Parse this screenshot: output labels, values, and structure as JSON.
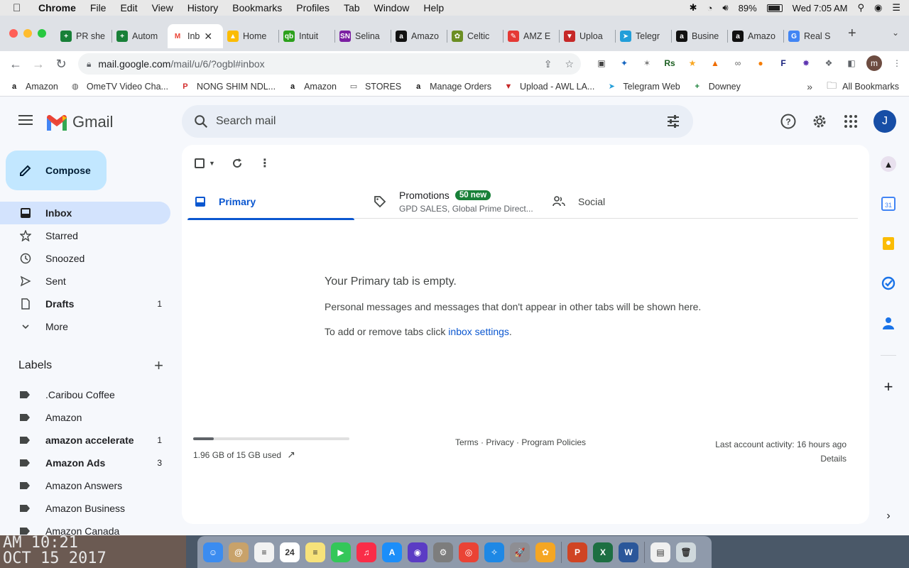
{
  "menubar": {
    "app": "Chrome",
    "items": [
      "File",
      "Edit",
      "View",
      "History",
      "Bookmarks",
      "Profiles",
      "Tab",
      "Window",
      "Help"
    ],
    "battery": "89%",
    "clock": "Wed 7:05 AM"
  },
  "tabs": [
    {
      "label": "PR she",
      "color": "#188038",
      "glyph": "+"
    },
    {
      "label": "Autom",
      "color": "#188038",
      "glyph": "+"
    },
    {
      "label": "Inb",
      "color": "#ffffff",
      "glyph": "M",
      "active": true
    },
    {
      "label": "Home",
      "color": "#fbbc04",
      "glyph": "▲"
    },
    {
      "label": "Intuit",
      "color": "#2ca01c",
      "glyph": "qb"
    },
    {
      "label": "Selina",
      "color": "#7b1fa2",
      "glyph": "SN"
    },
    {
      "label": "Amazo",
      "color": "#111111",
      "glyph": "a"
    },
    {
      "label": "Celtic",
      "color": "#6b8e23",
      "glyph": "✿"
    },
    {
      "label": "AMZ E",
      "color": "#e53935",
      "glyph": "✎"
    },
    {
      "label": "Uploa",
      "color": "#c62828",
      "glyph": "▼"
    },
    {
      "label": "Telegr",
      "color": "#229ed9",
      "glyph": "➤"
    },
    {
      "label": "Busine",
      "color": "#111111",
      "glyph": "a"
    },
    {
      "label": "Amazo",
      "color": "#111111",
      "glyph": "a"
    },
    {
      "label": "Real S",
      "color": "#4285f4",
      "glyph": "G"
    }
  ],
  "address": {
    "host": "mail.google.com",
    "path": "/mail/u/6/?ogbl#inbox"
  },
  "bookmarks": [
    {
      "label": "Amazon",
      "color": "#111111",
      "glyph": "a"
    },
    {
      "label": "OmeTV Video Cha...",
      "color": "#555555",
      "glyph": "◍"
    },
    {
      "label": "NONG SHIM NDL...",
      "color": "#d32f2f",
      "glyph": "P"
    },
    {
      "label": "Amazon",
      "color": "#111111",
      "glyph": "a"
    },
    {
      "label": "STORES",
      "color": "#555555",
      "glyph": "▭"
    },
    {
      "label": "Manage Orders",
      "color": "#111111",
      "glyph": "a"
    },
    {
      "label": "Upload - AWL LA...",
      "color": "#c62828",
      "glyph": "▼"
    },
    {
      "label": "Telegram Web",
      "color": "#229ed9",
      "glyph": "➤"
    },
    {
      "label": "Downey",
      "color": "#188038",
      "glyph": "+"
    }
  ],
  "bookmarks_more": "»",
  "bookmarks_all": "All Bookmarks",
  "gmail": {
    "logo_text": "Gmail",
    "search_placeholder": "Search mail",
    "avatar_letter": "J",
    "compose_label": "Compose",
    "nav": [
      {
        "label": "Inbox",
        "icon": "inbox-icon",
        "active": true,
        "count": ""
      },
      {
        "label": "Starred",
        "icon": "star-icon",
        "count": ""
      },
      {
        "label": "Snoozed",
        "icon": "clock-icon",
        "count": ""
      },
      {
        "label": "Sent",
        "icon": "send-icon",
        "count": ""
      },
      {
        "label": "Drafts",
        "icon": "draft-icon",
        "bold": true,
        "count": "1"
      },
      {
        "label": "More",
        "icon": "chevron-down-icon",
        "count": ""
      }
    ],
    "labels_title": "Labels",
    "labels": [
      {
        "label": ".Caribou Coffee",
        "count": ""
      },
      {
        "label": "Amazon",
        "count": ""
      },
      {
        "label": "amazon accelerate",
        "bold": true,
        "count": "1"
      },
      {
        "label": "Amazon Ads",
        "bold": true,
        "count": "3"
      },
      {
        "label": "Amazon Answers",
        "count": ""
      },
      {
        "label": "Amazon Business",
        "count": ""
      },
      {
        "label": "Amazon Canada",
        "count": ""
      }
    ],
    "categories": {
      "primary": "Primary",
      "promotions": "Promotions",
      "promotions_badge": "50 new",
      "promotions_sub": "GPD SALES, Global Prime Direct...",
      "social": "Social"
    },
    "empty": {
      "title": "Your Primary tab is empty.",
      "text": "Personal messages and messages that don't appear in other tabs will be shown here.",
      "settings_prefix": "To add or remove tabs click ",
      "settings_link": "inbox settings",
      "settings_suffix": "."
    },
    "footer": {
      "storage": "1.96 GB of 15 GB used",
      "storage_fraction": 0.13,
      "links": "Terms · Privacy · Program Policies",
      "activity": "Last account activity: 16 hours ago",
      "details": "Details"
    }
  },
  "desktop": {
    "photo_line1": "AM 10:21",
    "photo_line2": "OCT 15 2017",
    "dock_apps": [
      {
        "name": "Finder",
        "color": "#3b8cf0",
        "glyph": "☺"
      },
      {
        "name": "Contacts",
        "color": "#c8a26a",
        "glyph": "@"
      },
      {
        "name": "Reminders",
        "color": "#f2f2f2",
        "glyph": "≡"
      },
      {
        "name": "Calendar",
        "color": "#ffffff",
        "glyph": "24"
      },
      {
        "name": "Notes",
        "color": "#f7e27a",
        "glyph": "≡"
      },
      {
        "name": "FaceTime",
        "color": "#34c759",
        "glyph": "▶"
      },
      {
        "name": "Music",
        "color": "#fa2d48",
        "glyph": "♫"
      },
      {
        "name": "App Store",
        "color": "#1c8ef9",
        "glyph": "A"
      },
      {
        "name": "Siri",
        "color": "#5b3cc4",
        "glyph": "◉"
      },
      {
        "name": "System Preferences",
        "color": "#7d7d7d",
        "glyph": "⚙"
      },
      {
        "name": "Chrome",
        "color": "#ea4335",
        "glyph": "◎"
      },
      {
        "name": "Safari",
        "color": "#1e88e5",
        "glyph": "✧"
      },
      {
        "name": "Launchpad",
        "color": "#8e8e93",
        "glyph": "🚀"
      },
      {
        "name": "Photos",
        "color": "#f5a623",
        "glyph": "✿"
      },
      {
        "name": "PowerPoint",
        "color": "#d04423",
        "glyph": "P"
      },
      {
        "name": "Excel",
        "color": "#1d6f42",
        "glyph": "X"
      },
      {
        "name": "Word",
        "color": "#2b579a",
        "glyph": "W"
      },
      {
        "name": "Document",
        "color": "#f0f0f0",
        "glyph": "▤"
      },
      {
        "name": "Trash",
        "color": "#cfd8dc",
        "glyph": "🗑"
      }
    ]
  }
}
